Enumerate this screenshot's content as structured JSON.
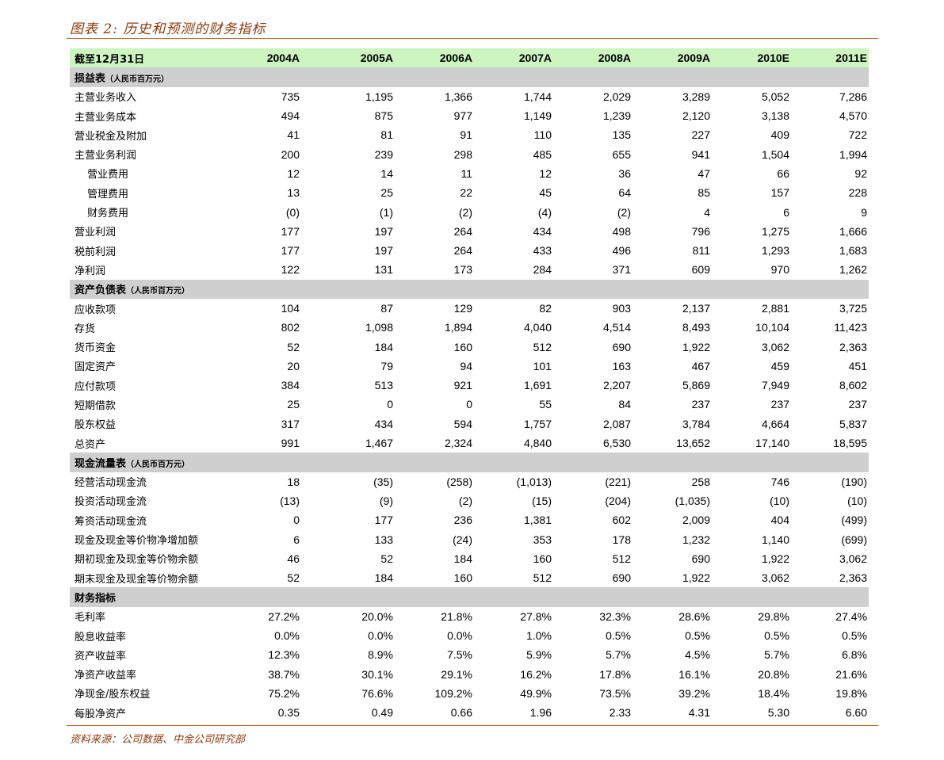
{
  "title": "图表 2:  历史和预测的财务指标",
  "source": "资料来源：公司数据、中金公司研究部",
  "header": {
    "label": "截至12月31日",
    "years": [
      "2004A",
      "2005A",
      "2006A",
      "2007A",
      "2008A",
      "2009A",
      "2010E",
      "2011E"
    ]
  },
  "sections": [
    {
      "title": "损益表",
      "unit": "（人民币百万元）",
      "rows": [
        {
          "label": "主营业务收入",
          "values": [
            "735",
            "1,195",
            "1,366",
            "1,744",
            "2,029",
            "3,289",
            "5,052",
            "7,286"
          ]
        },
        {
          "label": "主营业务成本",
          "values": [
            "494",
            "875",
            "977",
            "1,149",
            "1,239",
            "2,120",
            "3,138",
            "4,570"
          ]
        },
        {
          "label": "营业税金及附加",
          "values": [
            "41",
            "81",
            "91",
            "110",
            "135",
            "227",
            "409",
            "722"
          ]
        },
        {
          "label": "主营业务利润",
          "values": [
            "200",
            "239",
            "298",
            "485",
            "655",
            "941",
            "1,504",
            "1,994"
          ]
        },
        {
          "label": "营业费用",
          "indent": true,
          "values": [
            "12",
            "14",
            "11",
            "12",
            "36",
            "47",
            "66",
            "92"
          ]
        },
        {
          "label": "管理费用",
          "indent": true,
          "values": [
            "13",
            "25",
            "22",
            "45",
            "64",
            "85",
            "157",
            "228"
          ]
        },
        {
          "label": "财务费用",
          "indent": true,
          "values": [
            "(0)",
            "(1)",
            "(2)",
            "(4)",
            "(2)",
            "4",
            "6",
            "9"
          ]
        },
        {
          "label": "营业利润",
          "values": [
            "177",
            "197",
            "264",
            "434",
            "498",
            "796",
            "1,275",
            "1,666"
          ]
        },
        {
          "label": "税前利润",
          "values": [
            "177",
            "197",
            "264",
            "433",
            "496",
            "811",
            "1,293",
            "1,683"
          ]
        },
        {
          "label": "净利润",
          "values": [
            "122",
            "131",
            "173",
            "284",
            "371",
            "609",
            "970",
            "1,262"
          ]
        }
      ]
    },
    {
      "title": "资产负债表",
      "unit": "（人民币百万元）",
      "rows": [
        {
          "label": "应收款项",
          "values": [
            "104",
            "87",
            "129",
            "82",
            "903",
            "2,137",
            "2,881",
            "3,725"
          ]
        },
        {
          "label": "存货",
          "values": [
            "802",
            "1,098",
            "1,894",
            "4,040",
            "4,514",
            "8,493",
            "10,104",
            "11,423"
          ]
        },
        {
          "label": "货币资金",
          "values": [
            "52",
            "184",
            "160",
            "512",
            "690",
            "1,922",
            "3,062",
            "2,363"
          ]
        },
        {
          "label": "固定资产",
          "values": [
            "20",
            "79",
            "94",
            "101",
            "163",
            "467",
            "459",
            "451"
          ]
        },
        {
          "label": "应付款项",
          "values": [
            "384",
            "513",
            "921",
            "1,691",
            "2,207",
            "5,869",
            "7,949",
            "8,602"
          ]
        },
        {
          "label": "短期借款",
          "values": [
            "25",
            "0",
            "0",
            "55",
            "84",
            "237",
            "237",
            "237"
          ]
        },
        {
          "label": "股东权益",
          "values": [
            "317",
            "434",
            "594",
            "1,757",
            "2,087",
            "3,784",
            "4,664",
            "5,837"
          ]
        },
        {
          "label": "总资产",
          "values": [
            "991",
            "1,467",
            "2,324",
            "4,840",
            "6,530",
            "13,652",
            "17,140",
            "18,595"
          ]
        }
      ]
    },
    {
      "title": "现金流量表",
      "unit": "（人民币百万元）",
      "rows": [
        {
          "label": "经营活动现金流",
          "values": [
            "18",
            "(35)",
            "(258)",
            "(1,013)",
            "(221)",
            "258",
            "746",
            "(190)"
          ]
        },
        {
          "label": "投资活动现金流",
          "values": [
            "(13)",
            "(9)",
            "(2)",
            "(15)",
            "(204)",
            "(1,035)",
            "(10)",
            "(10)"
          ]
        },
        {
          "label": "筹资活动现金流",
          "values": [
            "0",
            "177",
            "236",
            "1,381",
            "602",
            "2,009",
            "404",
            "(499)"
          ]
        },
        {
          "label": "现金及现金等价物净增加额",
          "values": [
            "6",
            "133",
            "(24)",
            "353",
            "178",
            "1,232",
            "1,140",
            "(699)"
          ]
        },
        {
          "label": "期初现金及现金等价物余额",
          "values": [
            "46",
            "52",
            "184",
            "160",
            "512",
            "690",
            "1,922",
            "3,062"
          ]
        },
        {
          "label": "期末现金及现金等价物余额",
          "values": [
            "52",
            "184",
            "160",
            "512",
            "690",
            "1,922",
            "3,062",
            "2,363"
          ]
        }
      ]
    },
    {
      "title": "财务指标",
      "unit": "",
      "rows": [
        {
          "label": "毛利率",
          "values": [
            "27.2%",
            "20.0%",
            "21.8%",
            "27.8%",
            "32.3%",
            "28.6%",
            "29.8%",
            "27.4%"
          ]
        },
        {
          "label": "股息收益率",
          "values": [
            "0.0%",
            "0.0%",
            "0.0%",
            "1.0%",
            "0.5%",
            "0.5%",
            "0.5%",
            "0.5%"
          ]
        },
        {
          "label": "资产收益率",
          "values": [
            "12.3%",
            "8.9%",
            "7.5%",
            "5.9%",
            "5.7%",
            "4.5%",
            "5.7%",
            "6.8%"
          ]
        },
        {
          "label": "净资产收益率",
          "values": [
            "38.7%",
            "30.1%",
            "29.1%",
            "16.2%",
            "17.8%",
            "16.1%",
            "20.8%",
            "21.6%"
          ]
        },
        {
          "label": "净现金/股东权益",
          "values": [
            "75.2%",
            "76.6%",
            "109.2%",
            "49.9%",
            "73.5%",
            "39.2%",
            "18.4%",
            "19.8%"
          ]
        },
        {
          "label": "每股净资产",
          "values": [
            "0.35",
            "0.49",
            "0.66",
            "1.96",
            "2.33",
            "4.31",
            "5.30",
            "6.60"
          ]
        }
      ]
    }
  ]
}
